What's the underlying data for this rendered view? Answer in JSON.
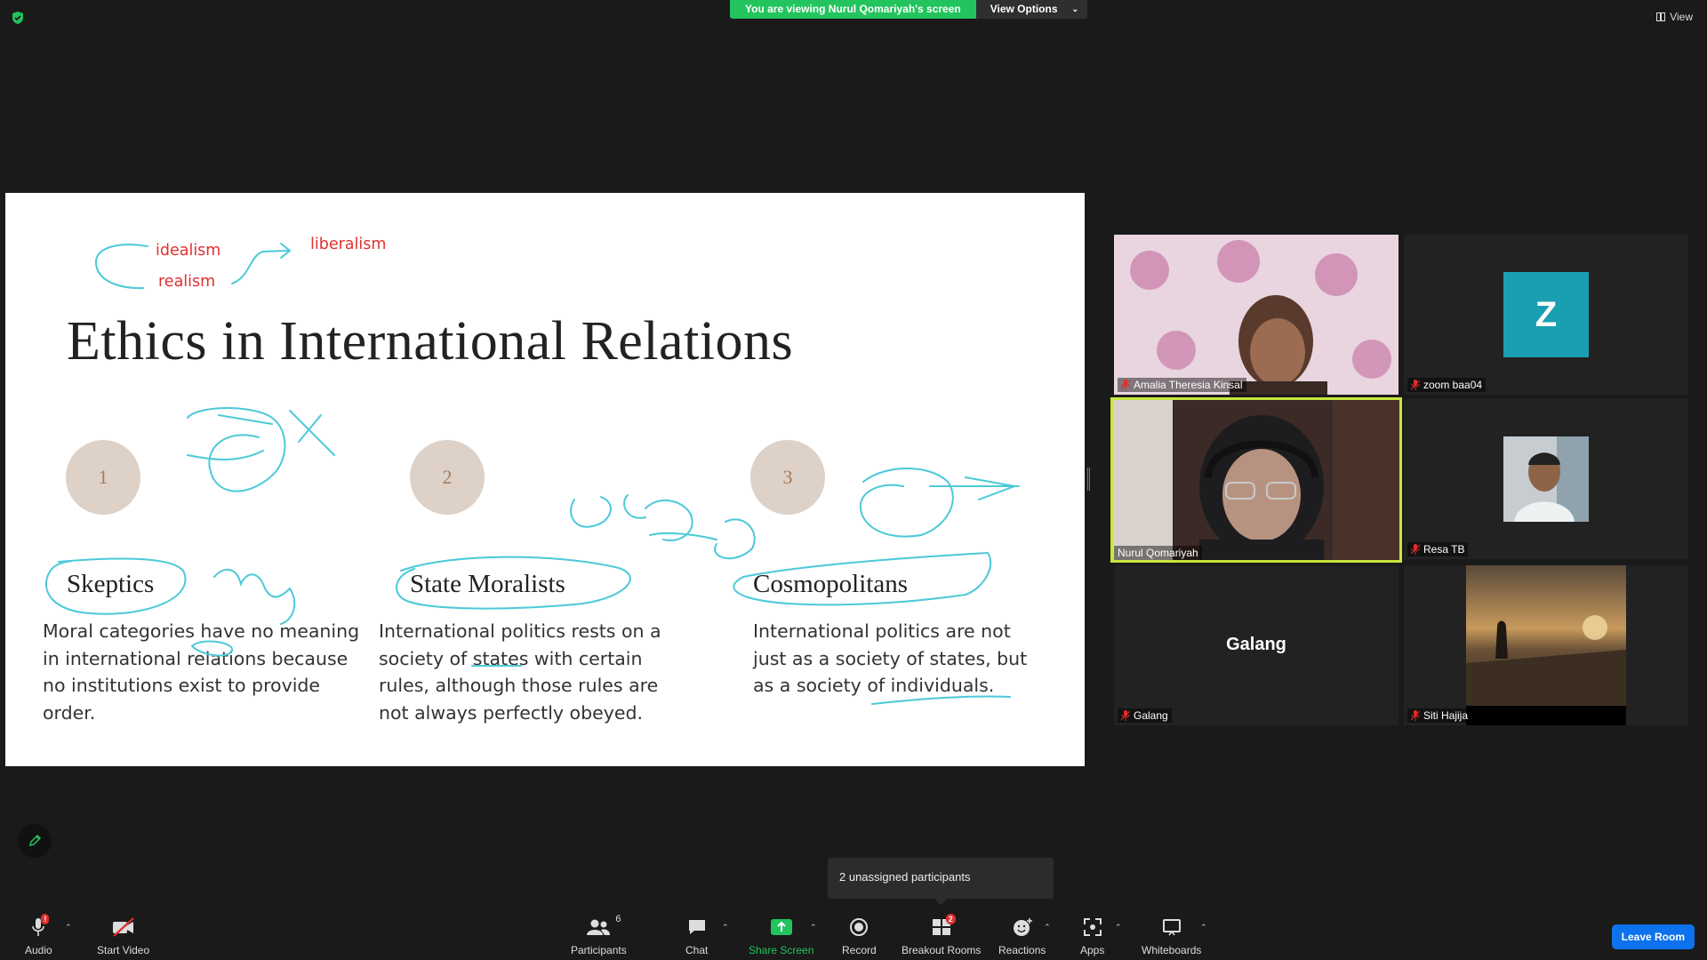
{
  "banner": {
    "viewing_text": "You are viewing Nurul Qomariyah's screen",
    "options_label": "View Options"
  },
  "view_label": "View",
  "slide": {
    "title": "Ethics in International Relations",
    "annotations": {
      "idealism": "idealism",
      "realism": "realism",
      "liberalism": "liberalism"
    },
    "columns": [
      {
        "number": "1",
        "heading": "Skeptics",
        "body": "Moral categories have no meaning in international relations because no institutions exist to provide order."
      },
      {
        "number": "2",
        "heading": "State Moralists",
        "body": "International politics rests on a society of states with certain rules, although those rules are not always perfectly obeyed."
      },
      {
        "number": "3",
        "heading": "Cosmopolitans",
        "body": "International politics are not just as a society of states, but as a society of individuals."
      }
    ]
  },
  "participants_tiles": [
    {
      "name": "Amalia Theresia Kinsal",
      "muted": true
    },
    {
      "name": "zoom baa04",
      "muted": true,
      "avatar_letter": "Z"
    },
    {
      "name": "Nurul Qomariyah",
      "muted": false,
      "active_speaker": true
    },
    {
      "name": "Resa TB",
      "muted": true
    },
    {
      "name": "Galang",
      "muted": true,
      "display_name": "Galang"
    },
    {
      "name": "Siti Hajija",
      "muted": true
    }
  ],
  "tooltip": "2 unassigned participants",
  "toolbar": {
    "audio": "Audio",
    "audio_badge": "!",
    "video": "Start Video",
    "participants": "Participants",
    "participants_count": "6",
    "chat": "Chat",
    "share": "Share Screen",
    "record": "Record",
    "breakout": "Breakout Rooms",
    "breakout_badge": "2",
    "reactions": "Reactions",
    "apps": "Apps",
    "whiteboards": "Whiteboards",
    "leave": "Leave Room"
  },
  "colors": {
    "share_green": "#23c45e",
    "leave_blue": "#0e72ed",
    "ink_cyan": "#4cc9d9",
    "annotation_red": "#e0312e",
    "speaker_outline": "#c8e63c",
    "avatar_teal": "#1a9fb2"
  }
}
